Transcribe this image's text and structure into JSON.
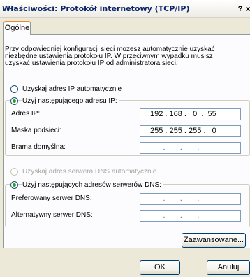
{
  "window": {
    "title": "Właściwości: Protokół internetowy (TCP/IP)",
    "help_button": "?",
    "close_button": "x"
  },
  "tabs": [
    {
      "label": "Ogólne",
      "active": true
    }
  ],
  "description": [
    "Przy odpowiedniej konfiguracji sieci możesz automatycznie uzyskać",
    "niezbędne ustawienia protokołu IP. W przeciwnym wypadku musisz",
    "uzyskać ustawienia protokołu IP od administratora sieci."
  ],
  "ip_section": {
    "auto_option": "Uzyskaj adres IP automatycznie",
    "manual_option": "Użyj następującego adresu IP:",
    "selected": "manual",
    "fields": [
      {
        "label": "Adres IP:",
        "value": "192 . 168 .   0  .  55"
      },
      {
        "label": "Maska podsieci:",
        "value": "255 . 255 . 255 .   0"
      },
      {
        "label": "Brama domyślna:",
        "value": "      .       .       ."
      }
    ]
  },
  "dns_section": {
    "auto_option": "Uzyskaj adres serwera DNS automatycznie",
    "auto_disabled": true,
    "manual_option": "Użyj następujących adresów serwerów DNS:",
    "selected": "manual",
    "fields": [
      {
        "label": "Preferowany serwer DNS:",
        "value": "      .       .       ."
      },
      {
        "label": "Alternatywny serwer DNS:",
        "value": "      .       .       ."
      }
    ]
  },
  "buttons": {
    "advanced": "Zaawansowane...",
    "ok": "OK",
    "cancel": "Anuluj"
  },
  "colors": {
    "title_text": "#0a246a",
    "dialog_background": "#ece9d8",
    "panel_background": "#fcfcfe",
    "tab_highlight": "#e68b2c",
    "radio_dot": "#21a121"
  }
}
